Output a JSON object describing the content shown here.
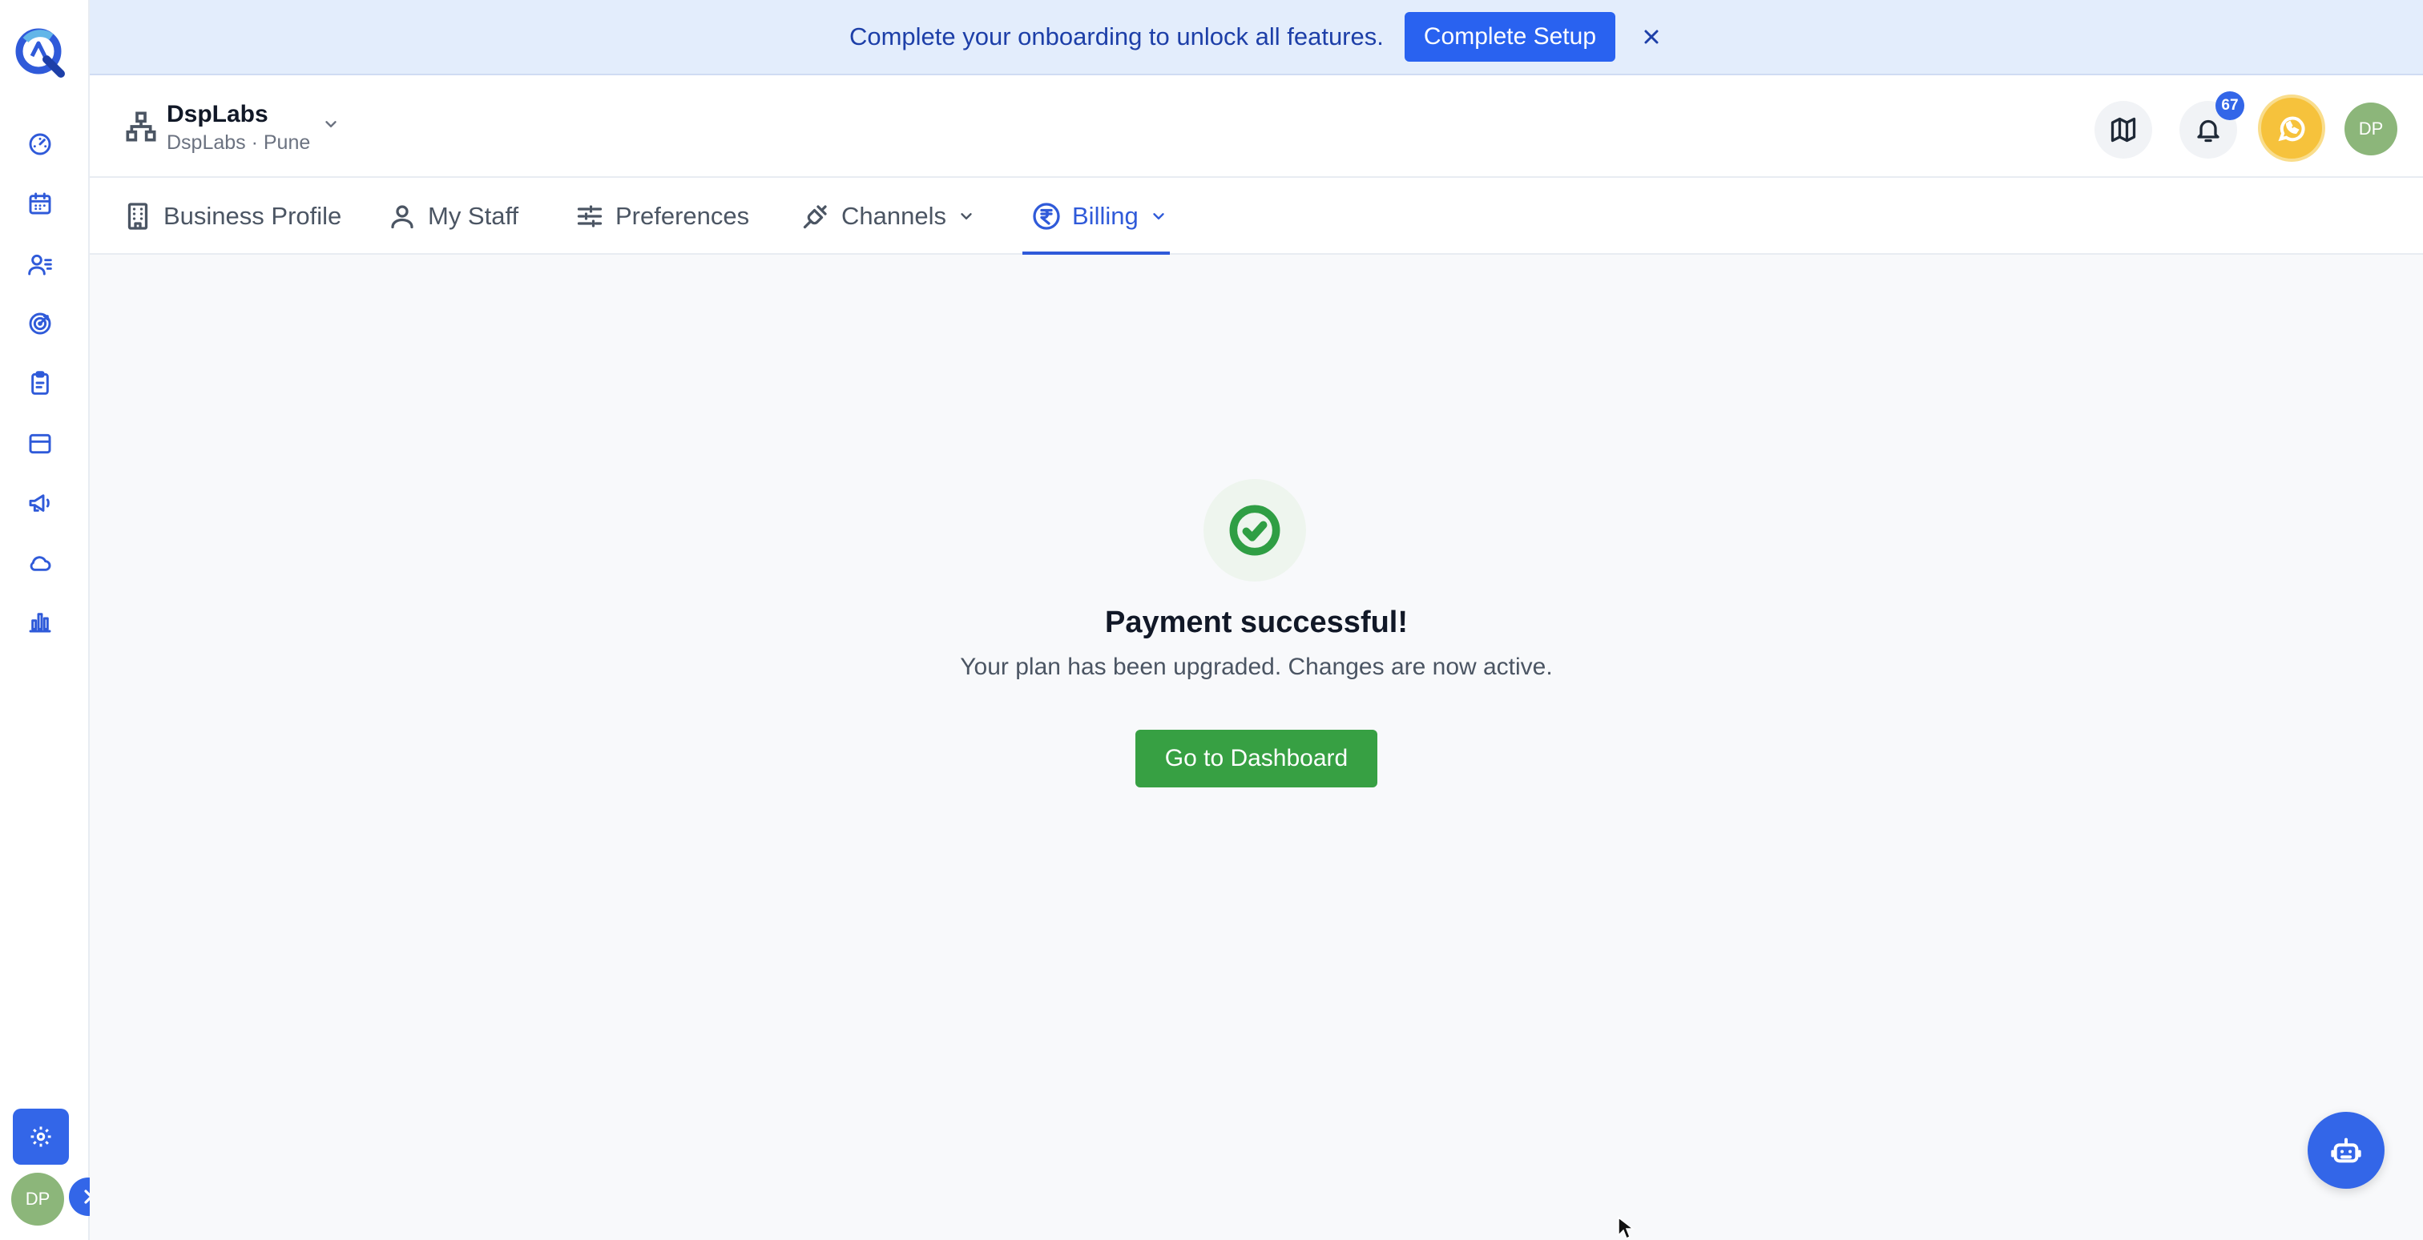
{
  "banner": {
    "message": "Complete your onboarding to unlock all features.",
    "cta_label": "Complete Setup",
    "close_icon": "close-icon"
  },
  "sidebar": {
    "icons": [
      "dashboard-icon",
      "calendar-icon",
      "contacts-icon",
      "target-icon",
      "clipboard-icon",
      "card-icon",
      "megaphone-icon",
      "cloud-icon",
      "chart-icon"
    ],
    "settings_icon": "gear-icon",
    "avatar_initials": "DP",
    "expand_icon": "chevron-right-icon"
  },
  "header": {
    "org_name": "DspLabs",
    "org_sub": "DspLabs · Pune",
    "notification_count": "67",
    "avatar_initials": "DP"
  },
  "tabs": [
    {
      "label": "Business Profile",
      "icon": "building-icon"
    },
    {
      "label": "My Staff",
      "icon": "user-icon"
    },
    {
      "label": "Preferences",
      "icon": "sliders-icon"
    },
    {
      "label": "Channels",
      "icon": "plug-icon"
    },
    {
      "label": "Billing",
      "icon": "rupee-icon",
      "active": true
    }
  ],
  "main": {
    "title": "Payment successful!",
    "subtitle": "Your plan has been upgraded. Changes are now active.",
    "button_label": "Go to Dashboard"
  },
  "colors": {
    "accent": "#2f5ad9",
    "success": "#37a043",
    "banner_bg": "#e3edfc"
  }
}
